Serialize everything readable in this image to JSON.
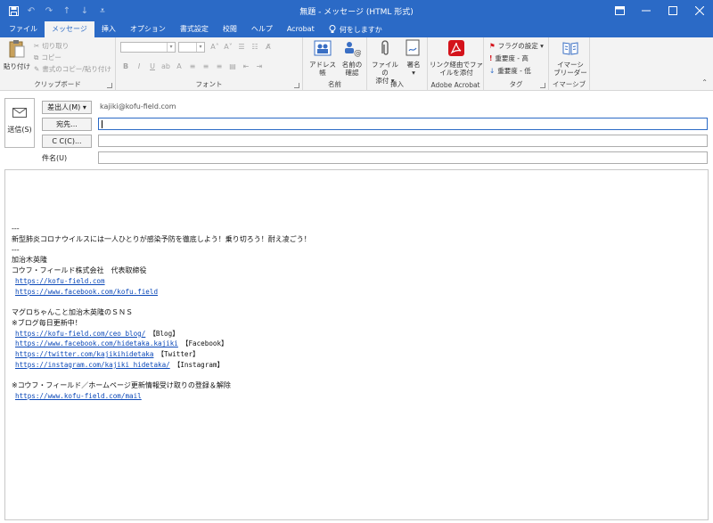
{
  "window": {
    "title": "無題 - メッセージ (HTML 形式)",
    "colors": {
      "accent": "#2b6ac6",
      "ribbon_bg": "#f3f3f3",
      "link": "#0b48b8"
    }
  },
  "quick_access": [
    "save-icon",
    "undo-icon",
    "redo-icon",
    "up-icon",
    "down-icon",
    "customize-icon"
  ],
  "tabs": [
    {
      "label": "ファイル"
    },
    {
      "label": "メッセージ",
      "active": true
    },
    {
      "label": "挿入"
    },
    {
      "label": "オプション"
    },
    {
      "label": "書式設定"
    },
    {
      "label": "校閲"
    },
    {
      "label": "ヘルプ"
    },
    {
      "label": "Acrobat"
    }
  ],
  "tell_me": "何をしますか",
  "ribbon": {
    "clipboard": {
      "label": "クリップボード",
      "paste": "貼り付け",
      "cut": "切り取り",
      "copy": "コピー",
      "format_painter": "書式のコピー/貼り付け"
    },
    "font": {
      "label": "フォント",
      "bold": "B",
      "italic": "I",
      "underline": "U"
    },
    "names": {
      "label": "名前",
      "address_book": "アドレス帳",
      "check_names": [
        "名前の",
        "確認"
      ]
    },
    "insert": {
      "label": "挿入",
      "attach_file": [
        "ファイルの",
        "添付 ▾"
      ],
      "signature": [
        "署名",
        "▾"
      ]
    },
    "acrobat": {
      "label": "Adobe Acrobat",
      "attach_link": [
        "リンク経由でファ",
        "イルを添付"
      ]
    },
    "tags": {
      "label": "タグ",
      "follow_up": "フラグの設定 ▾",
      "high": "重要度 - 高",
      "low": "重要度 - 低"
    },
    "immersive": {
      "label": "イマーシブ",
      "reader": [
        "イマーシ",
        "ブリーダー"
      ]
    }
  },
  "header": {
    "send": "送信(S)",
    "from_button": "差出人(M) ▾",
    "from_address": "kajiki@kofu-field.com",
    "to_button": "宛先...",
    "cc_button": "C C(C)...",
    "subject_label": "件名(U)"
  },
  "body": {
    "lines": [
      {
        "text": "---"
      },
      {
        "text": "新型肺炎コロナウイルスには一人ひとりが感染予防を徹底しよう！乗り切ろう！耐え凌ごう！"
      },
      {
        "text": "---"
      },
      {
        "text": "加治木英隆"
      },
      {
        "text": "コウフ・フィールド株式会社　代表取締役"
      },
      {
        "link": "https://kofu-field.com",
        "indent": true
      },
      {
        "link": "https://www.facebook.com/kofu.field",
        "indent": true
      },
      {
        "text": ""
      },
      {
        "text": "マグロちゃんこと加治木英隆のＳＮＳ"
      },
      {
        "text": "※ブログ毎日更新中！"
      },
      {
        "link": "https://kofu-field.com/ceo_blog/",
        "suffix": "【Blog】",
        "indent": true
      },
      {
        "link": "https://www.facebook.com/hidetaka.kajiki",
        "suffix": "【Facebook】",
        "indent": true
      },
      {
        "link": "https://twitter.com/kajikihidetaka",
        "suffix": "【Twitter】",
        "indent": true
      },
      {
        "link": "https://instagram.com/kajiki_hidetaka/",
        "suffix": "【Instagram】",
        "indent": true
      },
      {
        "text": ""
      },
      {
        "text": "※コウフ・フィールド／ホームページ更新情報受け取りの登録＆解除"
      },
      {
        "link": "https://www.kofu-field.com/mail",
        "indent": true
      }
    ]
  }
}
